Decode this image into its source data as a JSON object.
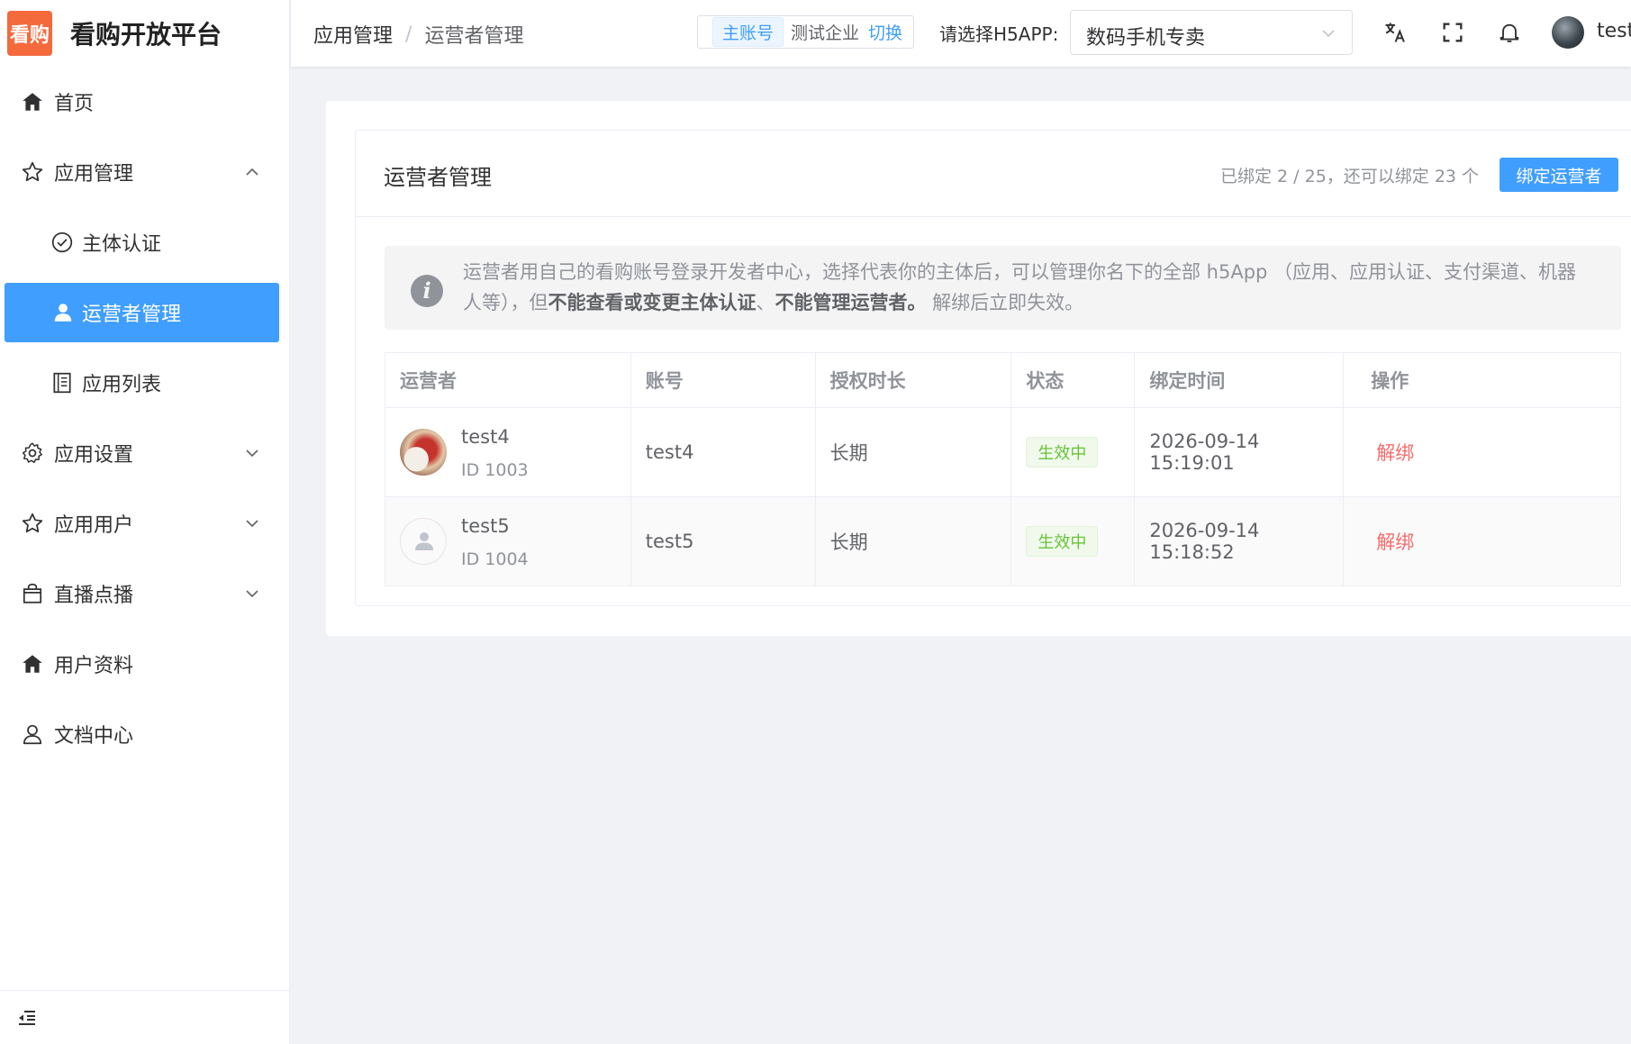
{
  "brand": {
    "logo_text": "看购",
    "title": "看购开放平台"
  },
  "sidebar": {
    "items": [
      {
        "label": "首页",
        "icon": "home-icon"
      },
      {
        "label": "应用管理",
        "icon": "star-icon"
      },
      {
        "label": "主体认证",
        "icon": "check-circle-icon"
      },
      {
        "label": "运营者管理",
        "icon": "user-icon"
      },
      {
        "label": "应用列表",
        "icon": "document-icon"
      },
      {
        "label": "应用设置",
        "icon": "gear-icon"
      },
      {
        "label": "应用用户",
        "icon": "star-icon"
      },
      {
        "label": "直播点播",
        "icon": "shopping-bag-icon"
      },
      {
        "label": "用户资料",
        "icon": "home-icon"
      },
      {
        "label": "文档中心",
        "icon": "user-outline-icon"
      }
    ]
  },
  "header": {
    "breadcrumb": [
      "应用管理",
      "运营者管理"
    ],
    "account_tag": "主账号",
    "enterprise": "测试企业",
    "switch_label": "切换",
    "h5_label": "请选择H5APP:",
    "h5_selected": "数码手机专卖",
    "username": "test"
  },
  "card": {
    "title": "运营者管理",
    "quota": "已绑定 2 / 25，还可以绑定 23 个",
    "bind_button": "绑定运营者"
  },
  "alert": {
    "text_a": "运营者用自己的看购账号登录开发者中心，选择代表你的主体后，可以管理你名下的全部 h5App （应用、应用认证、支付渠道、机器人等），但",
    "bold_a": "不能查看或变更主体认证",
    "text_b": "、",
    "bold_b": "不能管理运营者。",
    "text_c": " 解绑后立即失效。"
  },
  "table": {
    "columns": [
      "运营者",
      "账号",
      "授权时长",
      "状态",
      "绑定时间",
      "操作"
    ],
    "rows": [
      {
        "name": "test4",
        "id": "ID 1003",
        "account": "test4",
        "duration": "长期",
        "status": "生效中",
        "bound_at": "2026-09-14 15:19:01",
        "action": "解绑"
      },
      {
        "name": "test5",
        "id": "ID 1004",
        "account": "test5",
        "duration": "长期",
        "status": "生效中",
        "bound_at": "2026-09-14 15:18:52",
        "action": "解绑"
      }
    ]
  },
  "colors": {
    "primary": "#409eff",
    "success": "#67c23a",
    "danger": "#f56c6c",
    "brand": "#f46a3d"
  }
}
